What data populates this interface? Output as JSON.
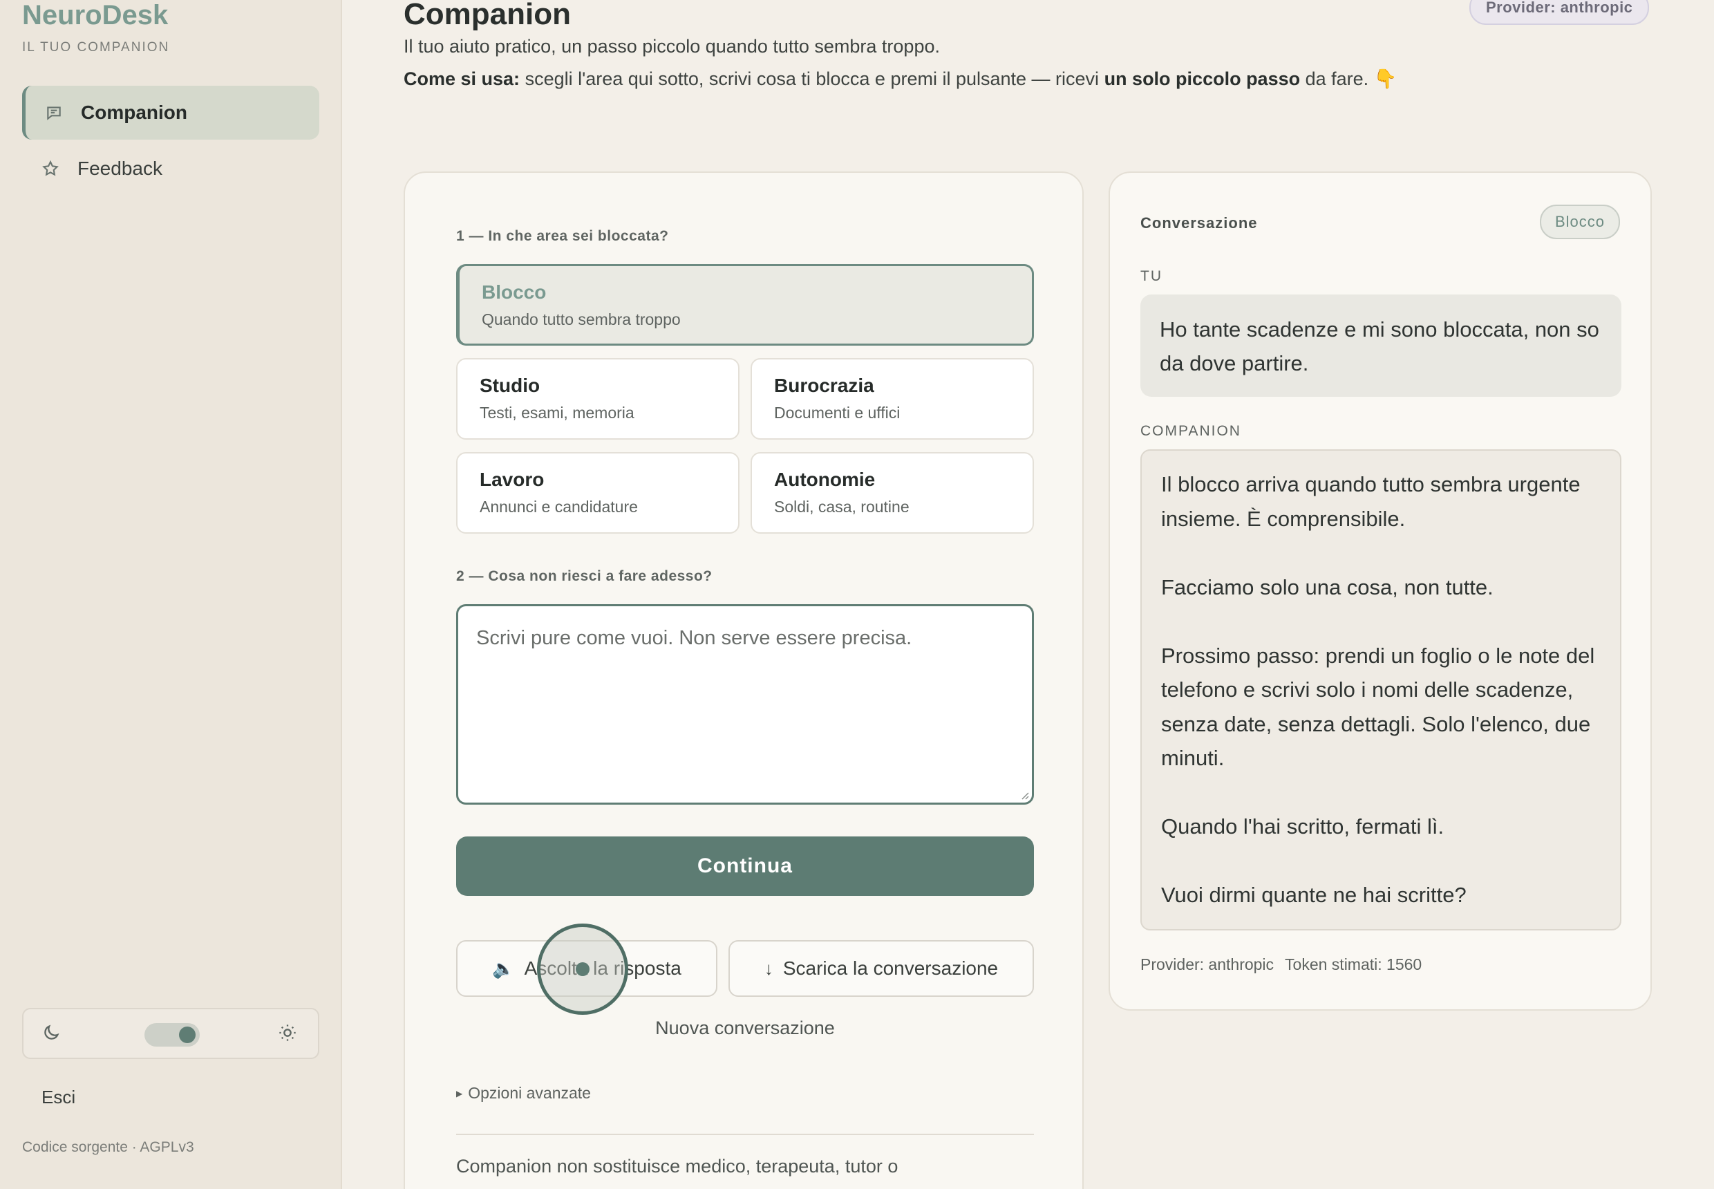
{
  "sidebar": {
    "brand": "NeuroDesk",
    "brand_subtitle": "IL TUO COMPANION",
    "items": [
      {
        "label": "Companion",
        "icon": "chat-icon",
        "active": true
      },
      {
        "label": "Feedback",
        "icon": "star-icon",
        "active": false
      }
    ],
    "theme": {
      "dark_icon": "moon-icon",
      "light_icon": "sun-icon"
    },
    "logout_label": "Esci",
    "source_label": "Codice sorgente · AGPLv3"
  },
  "header": {
    "title": "Companion",
    "provider_badge": "Provider: anthropic",
    "subtitle": "Il tuo aiuto pratico, un passo piccolo quando tutto sembra troppo.",
    "howto": {
      "bold_lead": "Come si usa:",
      "text_1": " scegli l'area qui sotto, scrivi cosa ti blocca e premi il pulsante — ricevi ",
      "bold_mid": "un solo piccolo passo",
      "text_2": " da fare. 👇"
    }
  },
  "form": {
    "step1_label": "1 — In che area sei bloccata?",
    "areas": [
      {
        "title": "Blocco",
        "subtitle": "Quando tutto sembra troppo",
        "selected": true
      },
      {
        "title": "Studio",
        "subtitle": "Testi, esami, memoria",
        "selected": false
      },
      {
        "title": "Burocrazia",
        "subtitle": "Documenti e uffici",
        "selected": false
      },
      {
        "title": "Lavoro",
        "subtitle": "Annunci e candidature",
        "selected": false
      },
      {
        "title": "Autonomie",
        "subtitle": "Soldi, casa, routine",
        "selected": false
      }
    ],
    "step2_label": "2 — Cosa non riesci a fare adesso?",
    "textarea_placeholder": "Scrivi pure come vuoi. Non serve essere precisa.",
    "continue_label": "Continua",
    "listen_icon": "🔈",
    "listen_label": "Ascolta la risposta",
    "download_icon": "↓",
    "download_label": "Scarica la conversazione",
    "new_conversation_label": "Nuova conversazione",
    "advanced_label": "Opzioni avanzate",
    "disclaimer": "Companion non sostituisce medico, terapeuta, tutor o"
  },
  "conversation": {
    "title": "Conversazione",
    "badge": "Blocco",
    "user_role": "TU",
    "user_message": "Ho tante scadenze e mi sono bloccata, non so da dove partire.",
    "bot_role": "COMPANION",
    "bot_paragraphs": [
      "Il blocco arriva quando tutto sembra urgente insieme. È comprensibile.",
      "Facciamo solo una cosa, non tutte.",
      "Prossimo passo: prendi un foglio o le note del telefono e scrivi solo i nomi delle scadenze, senza date, senza dettagli. Solo l'elenco, due minuti.",
      "Quando l'hai scritto, fermati lì.",
      "Vuoi dirmi quante ne hai scritte?"
    ],
    "provider_meta": "Provider: anthropic",
    "tokens_meta": "Token stimati: 1560"
  },
  "colors": {
    "accent": "#5d7c73",
    "brand": "#7a9a90",
    "background": "#f3efe8",
    "sidebar": "#ece6dc"
  }
}
